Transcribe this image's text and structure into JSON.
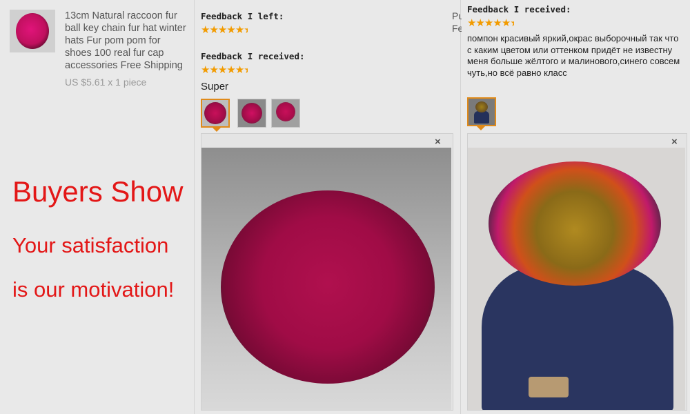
{
  "product": {
    "title": "13cm Natural raccoon fur ball key chain fur hat winter hats Fur pom pom for shoes 100 real fur cap accessories Free Shipping",
    "price": "US $5.61 x 1 piece"
  },
  "promo": {
    "line1": "Buyers Show",
    "line2": "Your satisfaction",
    "line3": "is our motivation!"
  },
  "feedback1": {
    "left_label": "Feedback I left:",
    "received_label": "Feedback I received:",
    "comment": "Super",
    "rating_left": 4.5,
    "rating_received": 4.5
  },
  "feedback2": {
    "partial_title": "Pu Fe",
    "received_label": "Feedback I received:",
    "rating_received": 4.5,
    "comment": "помпон красивый яркий,окрас выборочный так что с каким цветом или оттенком придёт не известну меня больше жёлтого и малинового,синего совсем чуть,но всё равно класс"
  },
  "icons": {
    "star": "★",
    "close": "×"
  },
  "colors": {
    "promo_red": "#e31717",
    "star_orange": "#f29b00",
    "selected_border": "#e08a1a"
  }
}
